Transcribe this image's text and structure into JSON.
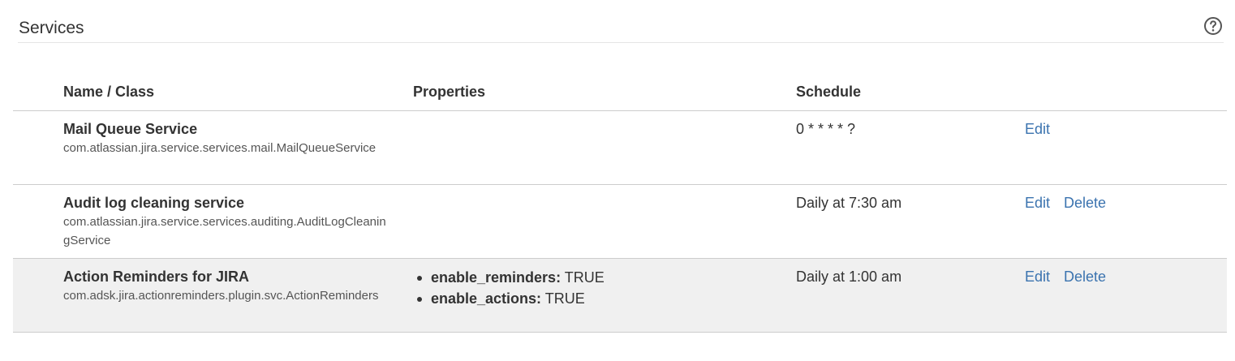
{
  "header": {
    "title": "Services",
    "help_icon": "question-circle-icon"
  },
  "table": {
    "columns": [
      "Name / Class",
      "Properties",
      "Schedule"
    ],
    "rows": [
      {
        "name": "Mail Queue Service",
        "class": "com.atlassian.jira.service.services.mail.MailQueueService",
        "properties": [],
        "schedule": "0 * * * * ?",
        "edit_label": "Edit",
        "delete_label": "",
        "highlighted": false
      },
      {
        "name": "Audit log cleaning service",
        "class": "com.atlassian.jira.service.services.auditing.AuditLogCleaningService",
        "properties": [],
        "schedule": "Daily at 7:30 am",
        "edit_label": "Edit",
        "delete_label": "Delete",
        "highlighted": false
      },
      {
        "name": "Action Reminders for JIRA",
        "class": "com.adsk.jira.actionreminders.plugin.svc.ActionReminders",
        "properties": [
          {
            "key": "enable_reminders:",
            "value": "TRUE"
          },
          {
            "key": "enable_actions:",
            "value": "TRUE"
          }
        ],
        "schedule": "Daily at 1:00 am",
        "edit_label": "Edit",
        "delete_label": "Delete",
        "highlighted": true
      }
    ]
  },
  "colors": {
    "link": "#3b73af",
    "highlight_row": "#f0f0f0",
    "text": "#333333"
  }
}
